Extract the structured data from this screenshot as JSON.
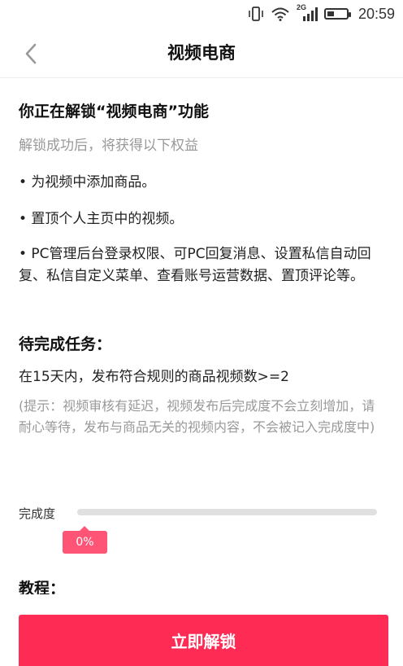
{
  "status_bar": {
    "network": "2G",
    "time": "20:59",
    "icons": [
      "vibrate-icon",
      "wifi-icon",
      "signal-icon",
      "battery-icon"
    ]
  },
  "header": {
    "back_icon": "chevron-left-icon",
    "title": "视频电商"
  },
  "main": {
    "title": "你正在解锁“视频电商”功能",
    "subtitle": "解锁成功后，将获得以下权益",
    "benefits": [
      "• 为视频中添加商品。",
      "• 置顶个人主页中的视频。",
      "• PC管理后台登录权限、可PC回复消息、设置私信自动回复、私信自定义菜单、查看账号运营数据、置顶评论等。"
    ],
    "tasks_title": "待完成任务：",
    "task_desc": "在15天内，发布符合规则的商品视频数>=2",
    "hint": "(提示：视频审核有延迟，视频发布后完成度不会立刻增加，请耐心等待，发布与商品无关的视频内容，不会被记入完成度中)"
  },
  "progress": {
    "label": "完成度",
    "value_text": "0%",
    "value": 0
  },
  "tutorial": {
    "title": "教程："
  },
  "footer": {
    "unlock_label": "立即解锁"
  },
  "colors": {
    "accent": "#fe2c55",
    "bubble": "#fe5577",
    "track": "#e0e0e0",
    "muted_text": "#999999"
  }
}
